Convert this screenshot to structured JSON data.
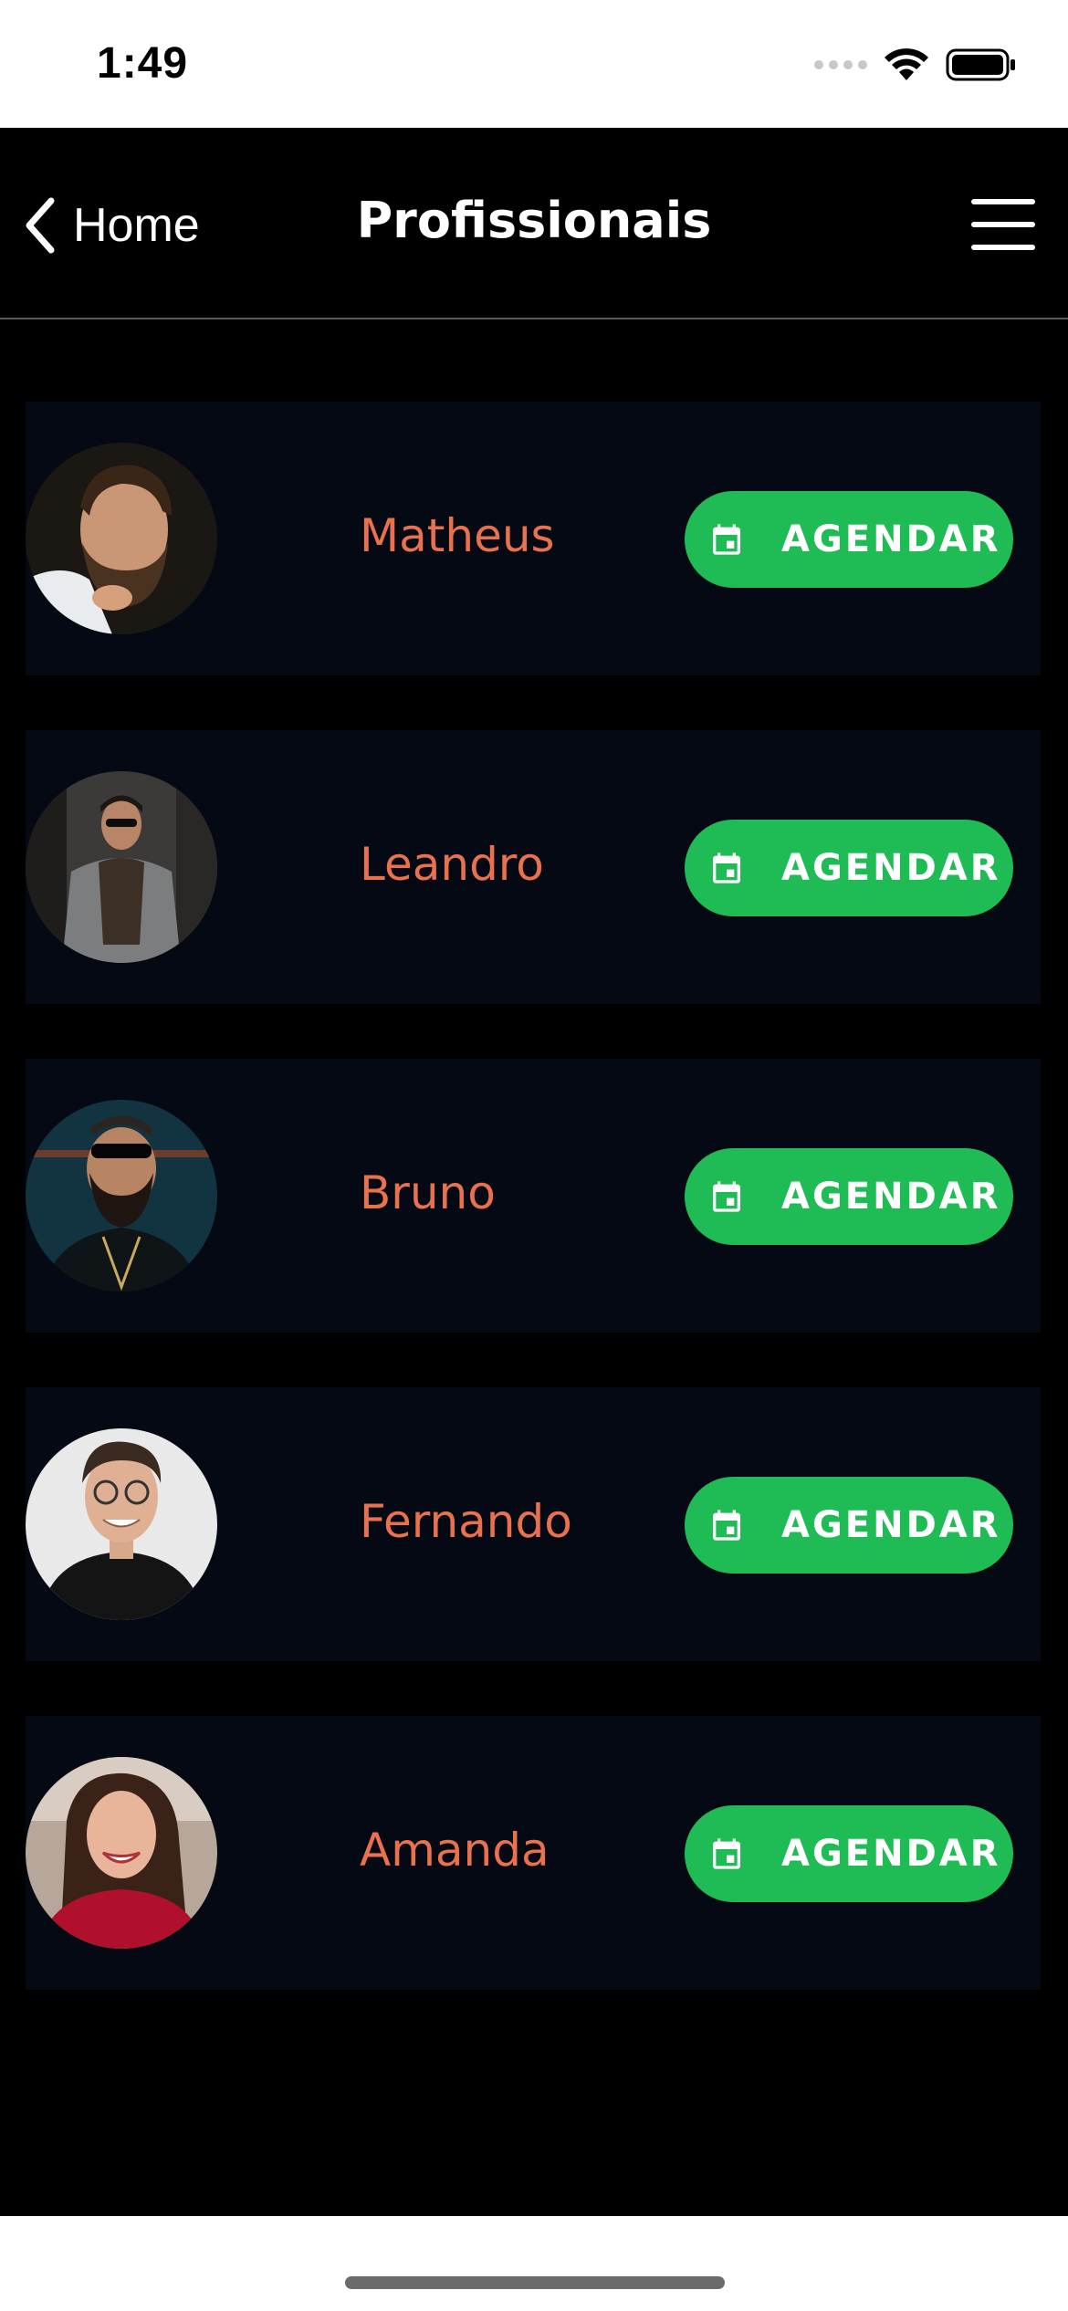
{
  "status_bar": {
    "time": "1:49"
  },
  "nav": {
    "back_label": "Home",
    "title": "Profissionais"
  },
  "colors": {
    "name": "#e9714e",
    "button": "#1fbb55",
    "card": "#050914"
  },
  "professionals": [
    {
      "name": "Matheus",
      "button_label": "AGENDAR",
      "button_icon": "calendar-icon"
    },
    {
      "name": "Leandro",
      "button_label": "AGENDAR",
      "button_icon": "calendar-icon"
    },
    {
      "name": "Bruno",
      "button_label": "AGENDAR",
      "button_icon": "calendar-icon"
    },
    {
      "name": "Fernando",
      "button_label": "AGENDAR",
      "button_icon": "calendar-icon"
    },
    {
      "name": "Amanda",
      "button_label": "AGENDAR",
      "button_icon": "calendar-icon"
    }
  ]
}
